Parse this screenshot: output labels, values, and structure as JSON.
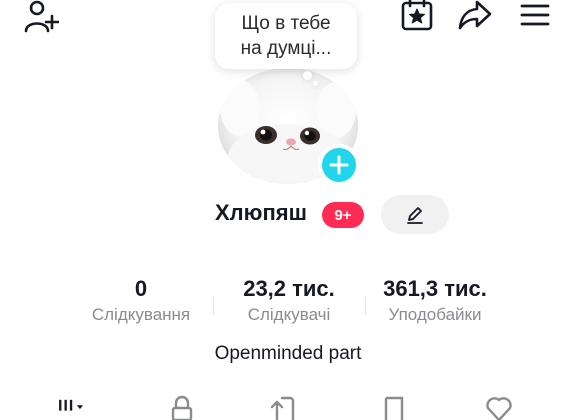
{
  "header": {
    "add_friend_icon": "person-plus-icon",
    "calendar_star_icon": "calendar-star-icon",
    "share_icon": "share-arrow-icon",
    "menu_icon": "hamburger-menu-icon"
  },
  "bubble": {
    "line1": "Що в тебе",
    "line2": "на думці..."
  },
  "profile": {
    "name": "Хлюпяш",
    "badge": "9+",
    "edit_icon": "pencil-icon"
  },
  "stats": [
    {
      "value": "0",
      "label": "Слідкування"
    },
    {
      "value": "23,2 тис.",
      "label": "Слідкувачі"
    },
    {
      "value": "361,3 тис.",
      "label": "Уподобайки"
    }
  ],
  "bio": "Openminded part",
  "tabs": [
    "videos-grid-icon",
    "lock-icon",
    "repost-icon",
    "bookmark-icon",
    "heart-icon"
  ],
  "colors": {
    "accent": "#fe2c55",
    "add_button": "#20d5ec",
    "label": "#8a8b91"
  }
}
